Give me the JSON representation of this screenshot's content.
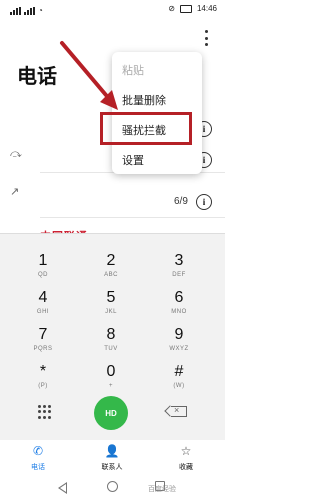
{
  "status_bar": {
    "time": "14:46"
  },
  "header": {
    "title": "电话"
  },
  "call_log": {
    "missed_count": "6/9",
    "carrier_label": "中国联通"
  },
  "menu": {
    "items": [
      {
        "label": "粘贴",
        "enabled": false
      },
      {
        "label": "批量删除",
        "enabled": true
      },
      {
        "label": "骚扰拦截",
        "enabled": true,
        "highlighted": true
      },
      {
        "label": "设置",
        "enabled": true
      }
    ]
  },
  "annotation": {
    "color": "#b52026"
  },
  "dialpad": {
    "keys": [
      {
        "digit": "1",
        "letters": "QD"
      },
      {
        "digit": "2",
        "letters": "ABC"
      },
      {
        "digit": "3",
        "letters": "DEF"
      },
      {
        "digit": "4",
        "letters": "GHI"
      },
      {
        "digit": "5",
        "letters": "JKL"
      },
      {
        "digit": "6",
        "letters": "MNO"
      },
      {
        "digit": "7",
        "letters": "PQRS"
      },
      {
        "digit": "8",
        "letters": "TUV"
      },
      {
        "digit": "9",
        "letters": "WXYZ"
      },
      {
        "digit": "*",
        "letters": "(P)"
      },
      {
        "digit": "0",
        "letters": "+"
      },
      {
        "digit": "#",
        "letters": "(W)"
      }
    ],
    "call_button_label": "HD",
    "call_color": "#34b84a"
  },
  "bottom_nav": {
    "items": [
      {
        "label": "电话",
        "icon": "phone-icon",
        "active": true
      },
      {
        "label": "联系人",
        "icon": "contacts-icon",
        "active": false
      },
      {
        "label": "收藏",
        "icon": "star-icon",
        "active": false
      }
    ],
    "accent": "#1f7ee6"
  },
  "watermark": "百度经验"
}
